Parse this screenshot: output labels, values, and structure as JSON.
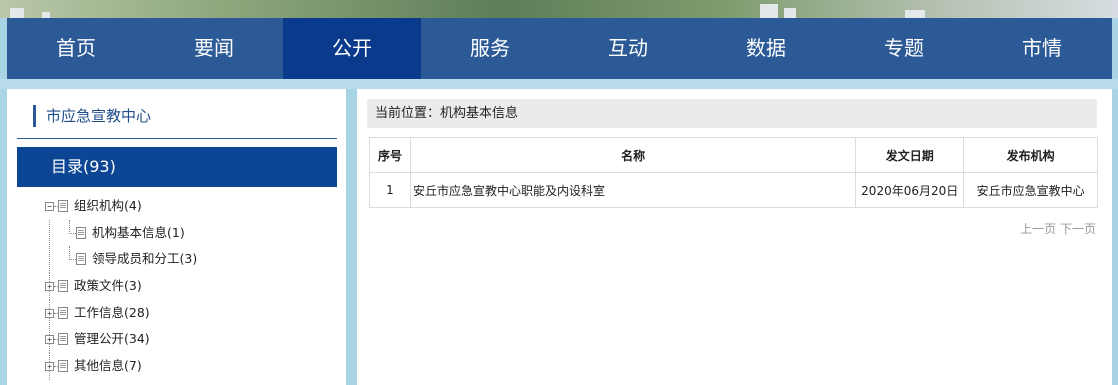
{
  "nav": {
    "items": [
      "首页",
      "要闻",
      "公开",
      "服务",
      "互动",
      "数据",
      "专题",
      "市情"
    ],
    "active_index": 2
  },
  "sidebar": {
    "title": "市应急宣教中心",
    "catalog": "目录(93)",
    "tree": [
      {
        "label": "组织机构(4)",
        "level": 0,
        "toggle": "−",
        "expanded": true
      },
      {
        "label": "机构基本信息(1)",
        "level": 1
      },
      {
        "label": "领导成员和分工(3)",
        "level": 1
      },
      {
        "label": "政策文件(3)",
        "level": 0,
        "toggle": "+"
      },
      {
        "label": "工作信息(28)",
        "level": 0,
        "toggle": "+"
      },
      {
        "label": "管理公开(34)",
        "level": 0,
        "toggle": "+"
      },
      {
        "label": "其他信息(7)",
        "level": 0,
        "toggle": "+"
      }
    ]
  },
  "main": {
    "breadcrumb": "当前位置：机构基本信息",
    "table": {
      "headers": [
        "序号",
        "名称",
        "发文日期",
        "发布机构"
      ],
      "rows": [
        [
          "1",
          "安丘市应急宣教中心职能及内设科室",
          "2020年06月20日",
          "安丘市应急宣教中心"
        ]
      ]
    },
    "pager": {
      "prev": "上一页",
      "next": "下一页"
    }
  },
  "colors": {
    "nav_bg": "#2b5a96",
    "nav_active": "#0a3a8c",
    "catalog_bg": "#0b4594",
    "page_bg": "#a9d4e6"
  }
}
